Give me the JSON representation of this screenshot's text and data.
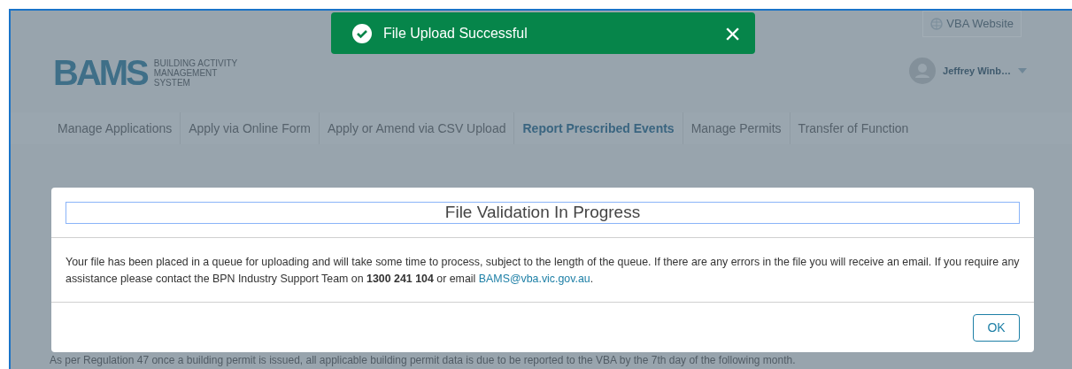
{
  "toast": {
    "message": "File Upload Successful",
    "close": "×"
  },
  "header": {
    "logo": {
      "mark": "BAMS",
      "lines": [
        "BUILDING ACTIVITY",
        "MANAGEMENT",
        "SYSTEM"
      ]
    },
    "website_link": "VBA Website",
    "user": "Jeffrey Winb…"
  },
  "nav": [
    {
      "label": "Manage Applications",
      "selected": false
    },
    {
      "label": "Apply via Online Form",
      "selected": false
    },
    {
      "label": "Apply or Amend via CSV Upload",
      "selected": false
    },
    {
      "label": "Report Prescribed Events",
      "selected": true
    },
    {
      "label": "Manage Permits",
      "selected": false
    },
    {
      "label": "Transfer of Function",
      "selected": false
    }
  ],
  "page_text": "As per Regulation 47 once a building permit is issued, all applicable building permit data is due to be reported to the VBA by the 7th day of the following month.",
  "dialog": {
    "title": "File Validation In Progress",
    "body": "Your file has been placed in a queue for uploading and will take some time to process, subject to the length of the queue. If there are any errors in the file you will receive an email. If you require any assistance please contact the BPN Industry Support Team on **1300 241 104** or email",
    "email": "BAMS@vba.vic.gov.au",
    "body_end": ".",
    "button": "OK"
  }
}
